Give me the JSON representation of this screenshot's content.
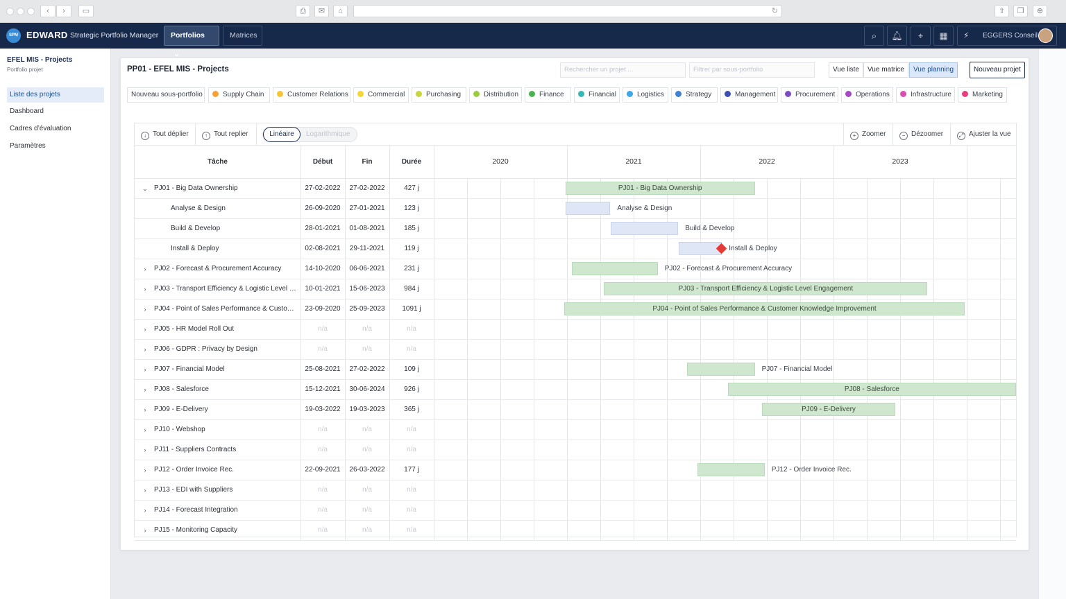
{
  "chrome": {
    "reload_icon": "reload-icon"
  },
  "app": {
    "logo_text": "SPM",
    "brand": "EDWARD",
    "brand_sub": "Strategic Portfolio Manager",
    "nav": [
      {
        "label": "Portfolios",
        "active": true
      },
      {
        "label": "Matrices",
        "active": false
      }
    ],
    "user": "EGGERS Conseil"
  },
  "sidebar": {
    "title": "EFEL MIS - Projects",
    "subtitle": "Portfolio projet",
    "items": [
      {
        "label": "Liste des projets",
        "active": true
      },
      {
        "label": "Dashboard",
        "active": false
      },
      {
        "label": "Cadres d’évaluation",
        "active": false
      },
      {
        "label": "Paramètres",
        "active": false
      }
    ]
  },
  "panel": {
    "title": "PP01 - EFEL MIS - Projects",
    "search_placeholder": "Rechercher un projet ...",
    "filter_placeholder": "Filtrer par sous-portfolio",
    "views": [
      "Vue liste",
      "Vue matrice",
      "Vue planning"
    ],
    "active_view": "Vue planning",
    "new_project": "Nouveau projet",
    "new_subportfolio": "Nouveau sous-portfolio",
    "tags": [
      {
        "label": "Supply Chain",
        "color": "#f5a13a"
      },
      {
        "label": "Customer Relations",
        "color": "#f7c531"
      },
      {
        "label": "Commercial",
        "color": "#f2d635"
      },
      {
        "label": "Purchasing",
        "color": "#c9d63a"
      },
      {
        "label": "Distribution",
        "color": "#9ccc3d"
      },
      {
        "label": "Finance",
        "color": "#4caf50"
      },
      {
        "label": "Financial",
        "color": "#35b8b0"
      },
      {
        "label": "Logistics",
        "color": "#3aa7e8"
      },
      {
        "label": "Strategy",
        "color": "#3f7fd6"
      },
      {
        "label": "Management",
        "color": "#3d4fb0"
      },
      {
        "label": "Procurement",
        "color": "#7b4bc0"
      },
      {
        "label": "Operations",
        "color": "#a44bc0"
      },
      {
        "label": "Infrastructure",
        "color": "#d84fb0"
      },
      {
        "label": "Marketing",
        "color": "#e83e7f"
      }
    ]
  },
  "gantt": {
    "toolbar": {
      "expand_all": "Tout déplier",
      "collapse_all": "Tout replier",
      "scale_linear": "Linéaire",
      "scale_log": "Logarithmique",
      "zoom_in": "Zoomer",
      "zoom_out": "Dézoomer",
      "fit": "Ajuster la vue"
    },
    "headers": {
      "task": "Tâche",
      "start": "Début",
      "end": "Fin",
      "duration": "Durée"
    },
    "years": [
      "2020",
      "2021",
      "2022",
      "2023"
    ],
    "rows": [
      {
        "task": "PJ01 - Big Data Ownership",
        "start": "27-02-2022",
        "end": "27-02-2022",
        "duration": "427 j",
        "expanded": true,
        "child": false,
        "bar": {
          "label": "PJ01 - Big Data Ownership",
          "inside": true,
          "milestone": false
        }
      },
      {
        "task": "Analyse & Design",
        "start": "26-09-2020",
        "end": "27-01-2021",
        "duration": "123 j",
        "child": true,
        "bar": {
          "label": "Analyse & Design",
          "inside": false,
          "milestone": false
        }
      },
      {
        "task": "Build & Develop",
        "start": "28-01-2021",
        "end": "01-08-2021",
        "duration": "185 j",
        "child": true,
        "bar": {
          "label": "Build & Develop",
          "inside": false,
          "milestone": false
        }
      },
      {
        "task": "Install & Deploy",
        "start": "02-08-2021",
        "end": "29-11-2021",
        "duration": "119 j",
        "child": true,
        "bar": {
          "label": "Install & Deploy",
          "inside": false,
          "milestone": true
        }
      },
      {
        "task": "PJ02 - Forecast & Procurement Accuracy",
        "start": "14-10-2020",
        "end": "06-06-2021",
        "duration": "231 j",
        "child": false,
        "bar": {
          "label": "PJ02 - Forecast & Procurement Accuracy",
          "inside": false,
          "milestone": false
        }
      },
      {
        "task": "PJ03 - Transport Efficiency & Logistic Level E...",
        "start": "10-01-2021",
        "end": "15-06-2023",
        "duration": "984 j",
        "child": false,
        "bar": {
          "label": "PJ03 - Transport Efficiency & Logistic Level Engagement",
          "inside": true,
          "milestone": false
        }
      },
      {
        "task": "PJ04 - Point of Sales Performance & Custom...",
        "start": "23-09-2020",
        "end": "25-09-2023",
        "duration": "1091 j",
        "child": false,
        "bar": {
          "label": "PJ04 - Point of Sales Performance & Customer Knowledge Improvement",
          "inside": true,
          "milestone": false
        }
      },
      {
        "task": "PJ05 - HR Model Roll Out",
        "start": "n/a",
        "end": "n/a",
        "duration": "n/a",
        "child": false,
        "bar": null
      },
      {
        "task": "PJ06 - GDPR : Privacy by Design",
        "start": "n/a",
        "end": "n/a",
        "duration": "n/a",
        "child": false,
        "bar": null
      },
      {
        "task": "PJ07 - Financial Model",
        "start": "25-08-2021",
        "end": "27-02-2022",
        "duration": "109 j",
        "child": false,
        "bar": {
          "label": "PJ07 - Financial Model",
          "inside": false,
          "milestone": false
        }
      },
      {
        "task": "PJ08 - Salesforce",
        "start": "15-12-2021",
        "end": "30-06-2024",
        "duration": "926 j",
        "child": false,
        "bar": {
          "label": "PJ08 - Salesforce",
          "inside": true,
          "milestone": false
        }
      },
      {
        "task": "PJ09 - E-Delivery",
        "start": "19-03-2022",
        "end": "19-03-2023",
        "duration": "365 j",
        "child": false,
        "bar": {
          "label": "PJ09 - E-Delivery",
          "inside": true,
          "milestone": false
        }
      },
      {
        "task": "PJ10 - Webshop",
        "start": "n/a",
        "end": "n/a",
        "duration": "n/a",
        "child": false,
        "bar": null
      },
      {
        "task": "PJ11 - Suppliers Contracts",
        "start": "n/a",
        "end": "n/a",
        "duration": "n/a",
        "child": false,
        "bar": null
      },
      {
        "task": "PJ12 - Order Invoice Rec.",
        "start": "22-09-2021",
        "end": "26-03-2022",
        "duration": "177 j",
        "child": false,
        "bar": {
          "label": "PJ12 - Order Invoice Rec.",
          "inside": false,
          "milestone": false
        }
      },
      {
        "task": "PJ13 - EDI with Suppliers",
        "start": "n/a",
        "end": "n/a",
        "duration": "n/a",
        "child": false,
        "bar": null
      },
      {
        "task": "PJ14 - Forecast Integration",
        "start": "n/a",
        "end": "n/a",
        "duration": "n/a",
        "child": false,
        "bar": null
      },
      {
        "task": "PJ15 - Monitoring Capacity",
        "start": "n/a",
        "end": "n/a",
        "duration": "n/a",
        "child": false,
        "bar": null
      }
    ]
  }
}
